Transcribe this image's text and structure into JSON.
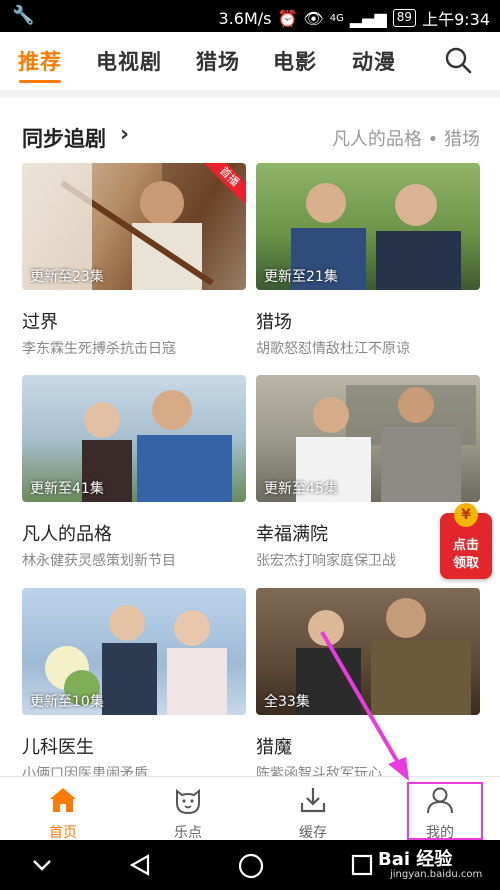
{
  "status_bar": {
    "speed": "3.6M/s",
    "network": "4G",
    "battery": "89",
    "time": "上午9:34"
  },
  "top_tabs": [
    {
      "label": "推荐",
      "active": true
    },
    {
      "label": "电视剧",
      "active": false
    },
    {
      "label": "猎场",
      "active": false
    },
    {
      "label": "电影",
      "active": false
    },
    {
      "label": "动漫",
      "active": false
    }
  ],
  "section": {
    "title": "同步追剧",
    "hint": "凡人的品格 • 猎场"
  },
  "cards": [
    {
      "title": "过界",
      "subtitle": "李东霖生死搏杀抗击日寇",
      "episode": "更新至23集",
      "badge": "首播"
    },
    {
      "title": "猎场",
      "subtitle": "胡歌怒怼情敌杜江不原谅",
      "episode": "更新至21集",
      "badge": ""
    },
    {
      "title": "凡人的品格",
      "subtitle": "林永健获灵感策划新节目",
      "episode": "更新至41集",
      "badge": ""
    },
    {
      "title": "幸福满院",
      "subtitle": "张宏杰打响家庭保卫战",
      "episode": "更新至45集",
      "badge": ""
    },
    {
      "title": "儿科医生",
      "subtitle": "小俩口因医患闹矛盾",
      "episode": "更新至10集",
      "badge": ""
    },
    {
      "title": "猎魔",
      "subtitle": "陈紫函智斗敌军玩心",
      "episode": "全33集",
      "badge": ""
    }
  ],
  "red_packet": {
    "coin": "¥",
    "line1": "点击",
    "line2": "领取"
  },
  "bottom_nav": [
    {
      "label": "首页",
      "icon": "home-icon",
      "active": true
    },
    {
      "label": "乐点",
      "icon": "dog-face-icon",
      "active": false
    },
    {
      "label": "缓存",
      "icon": "download-icon",
      "active": false
    },
    {
      "label": "我的",
      "icon": "user-icon",
      "active": false
    }
  ],
  "watermark": {
    "main": "Bai 经验",
    "sub": "jingyan.baidu.com"
  },
  "colors": {
    "accent": "#ff7a00",
    "highlight": "#e83ce0",
    "badge": "#e8232c"
  }
}
